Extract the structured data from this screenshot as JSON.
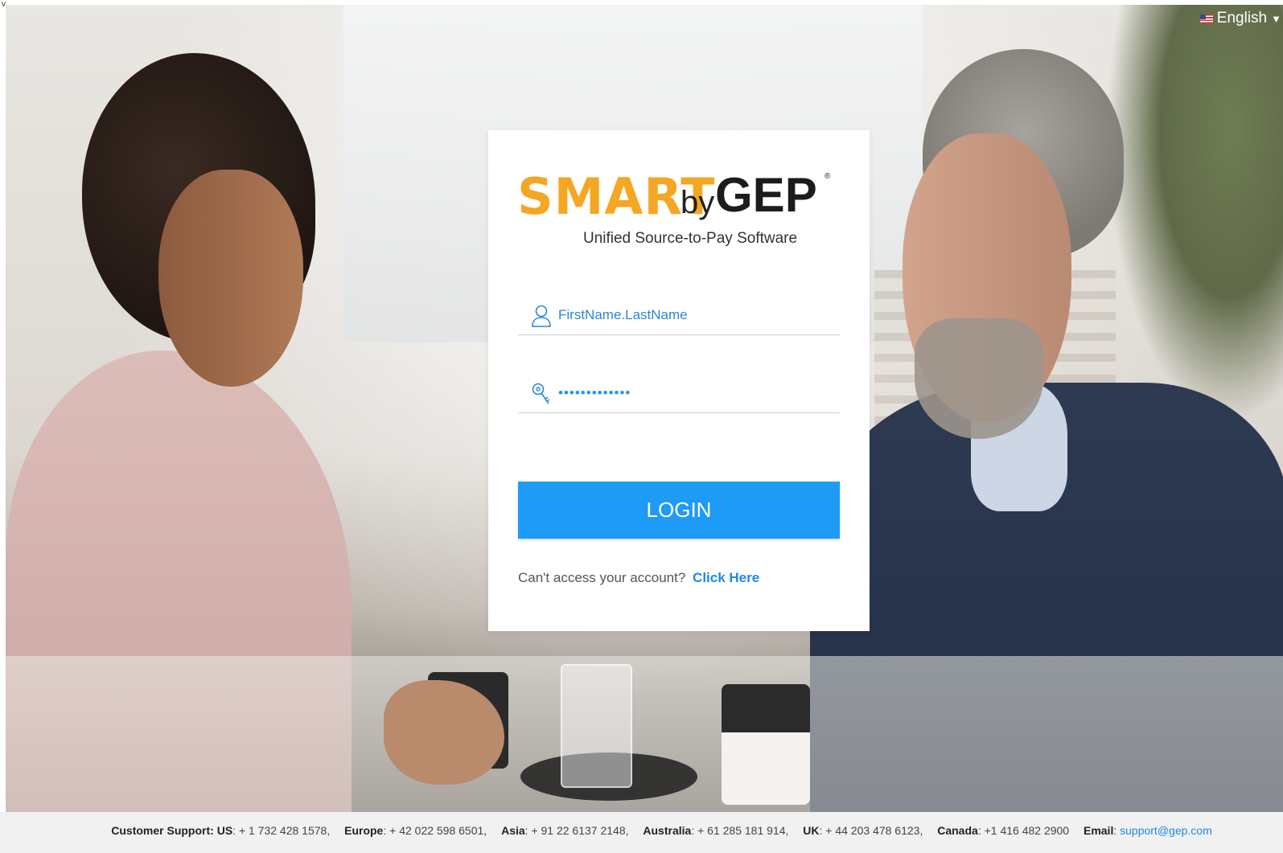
{
  "corner_mark": "v",
  "language": {
    "label": "English",
    "flag_icon": "us-flag-icon",
    "chevron_icon": "chevron-down-icon"
  },
  "logo": {
    "smart": "SMART",
    "by": "by",
    "gep": "GEP",
    "registered": "®",
    "colors": {
      "smart": "#f5a623",
      "gep": "#1c1c1c"
    }
  },
  "tagline": "Unified Source-to-Pay Software",
  "login_form": {
    "username": {
      "placeholder": "FirstName.LastName",
      "value": "",
      "icon": "user-icon"
    },
    "password": {
      "value": "•••••••••••••",
      "icon": "key-icon"
    },
    "login_button": "LOGIN",
    "help_text": "Can't access your account?",
    "help_link": "Click Here",
    "accent_color": "#1e9bf6"
  },
  "footer": {
    "support_label": "Customer Support:",
    "contacts": [
      {
        "label": "US",
        "value": "+ 1 732 428 1578,"
      },
      {
        "label": "Europe",
        "value": "+ 42 022 598 6501,"
      },
      {
        "label": "Asia",
        "value": "+ 91 22 6137 2148,"
      },
      {
        "label": "Australia",
        "value": "+ 61 285 181 914,"
      },
      {
        "label": "UK",
        "value": "+ 44 203 478 6123,"
      },
      {
        "label": "Canada",
        "value": "+1 416 482 2900"
      }
    ],
    "email_label": "Email",
    "email": "support@gep.com"
  }
}
